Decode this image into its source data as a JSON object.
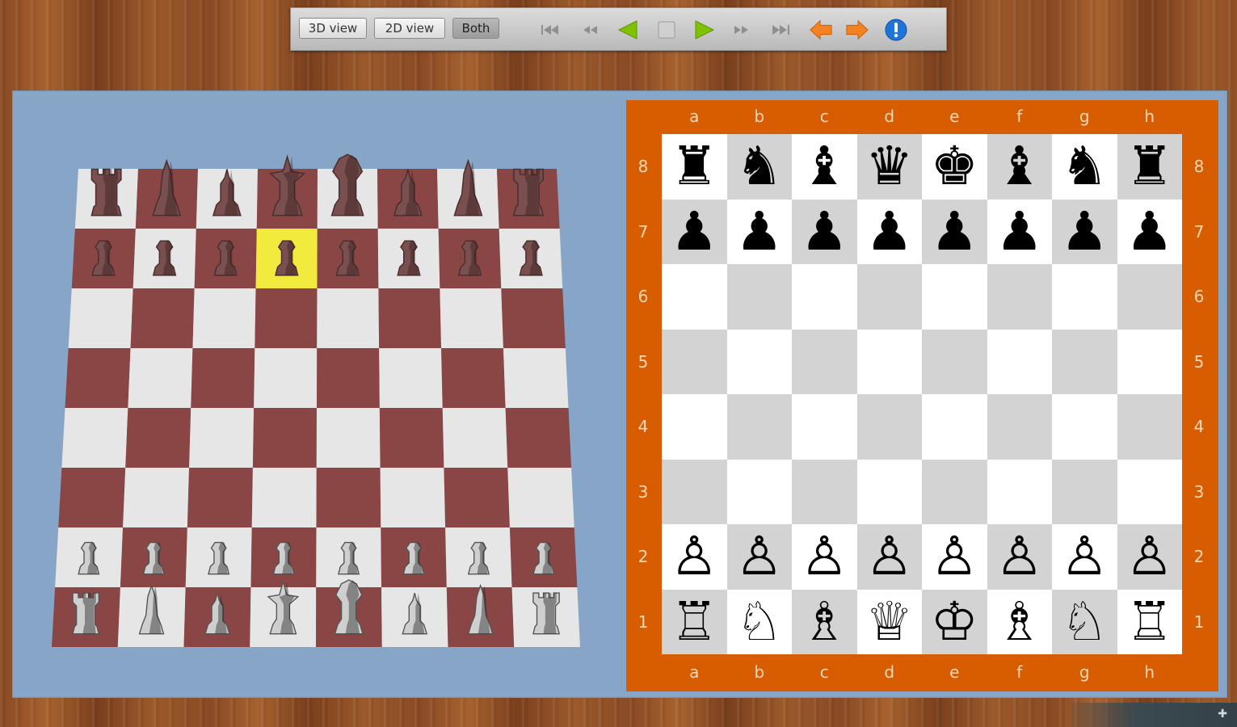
{
  "toolbar": {
    "view_3d_label": "3D view",
    "view_2d_label": "2D view",
    "view_both_label": "Both",
    "active_view": "Both",
    "icons": [
      "first-move-icon",
      "previous-move-icon",
      "play-back-icon",
      "stop-icon",
      "play-icon",
      "next-move-icon",
      "last-move-icon",
      "undo-arrow-icon",
      "redo-arrow-icon",
      "info-icon"
    ]
  },
  "colors": {
    "board2d_frame": "#d85c00",
    "board2d_light": "#ffffff",
    "board2d_dark": "#d3d3d3",
    "board3d_light": "#e6e6e6",
    "board3d_dark": "#8a4545",
    "board3d_highlight": "#f2ea3c",
    "panel_bg": "#87a5c6",
    "play_green": "#7ec200",
    "arrow_orange": "#f58220",
    "info_blue": "#1f74d8"
  },
  "board2d": {
    "files": [
      "a",
      "b",
      "c",
      "d",
      "e",
      "f",
      "g",
      "h"
    ],
    "ranks": [
      "8",
      "7",
      "6",
      "5",
      "4",
      "3",
      "2",
      "1"
    ],
    "position": [
      [
        "♜",
        "♞",
        "♝",
        "♛",
        "♚",
        "♝",
        "♞",
        "♜"
      ],
      [
        "♟",
        "♟",
        "♟",
        "♟",
        "♟",
        "♟",
        "♟",
        "♟"
      ],
      [
        "",
        "",
        "",
        "",
        "",
        "",
        "",
        ""
      ],
      [
        "",
        "",
        "",
        "",
        "",
        "",
        "",
        ""
      ],
      [
        "",
        "",
        "",
        "",
        "",
        "",
        "",
        ""
      ],
      [
        "",
        "",
        "",
        "",
        "",
        "",
        "",
        ""
      ],
      [
        "♙",
        "♙",
        "♙",
        "♙",
        "♙",
        "♙",
        "♙",
        "♙"
      ],
      [
        "♖",
        "♘",
        "♗",
        "♕",
        "♔",
        "♗",
        "♘",
        "♖"
      ]
    ]
  },
  "board3d": {
    "highlighted_square": "d7",
    "pieces": {
      "black_back_rank": [
        "rook",
        "knight",
        "bishop",
        "queen",
        "king",
        "bishop",
        "knight",
        "rook"
      ],
      "black_pawns": 8,
      "white_pawns": 8,
      "white_back_rank": [
        "rook",
        "knight",
        "bishop",
        "queen",
        "king",
        "bishop",
        "knight",
        "rook"
      ]
    }
  }
}
